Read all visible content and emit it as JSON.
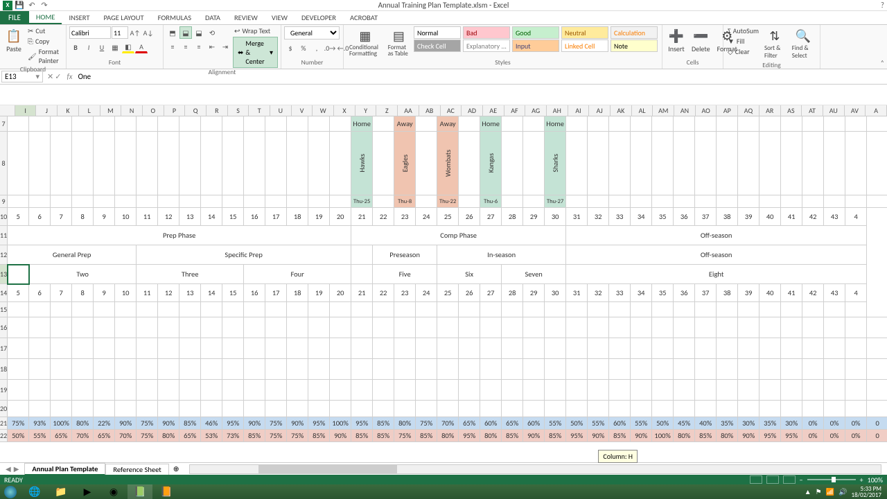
{
  "app": {
    "title": "Annual Training Plan Template.xlsm - Excel"
  },
  "qat": {
    "save": "💾",
    "undo": "↶",
    "redo": "↷"
  },
  "tabs": [
    "FILE",
    "HOME",
    "INSERT",
    "PAGE LAYOUT",
    "FORMULAS",
    "DATA",
    "REVIEW",
    "VIEW",
    "DEVELOPER",
    "ACROBAT"
  ],
  "ribbon": {
    "clipboard": {
      "label": "Clipboard",
      "paste": "Paste",
      "cut": "Cut",
      "copy": "Copy",
      "fp": "Format Painter"
    },
    "font": {
      "label": "Font",
      "name": "Calibri",
      "size": "11"
    },
    "alignment": {
      "label": "Alignment",
      "wrap": "Wrap Text",
      "merge": "Merge & Center"
    },
    "number": {
      "label": "Number",
      "format": "General"
    },
    "styles": {
      "label": "Styles",
      "cond": "Conditional Formatting",
      "fat": "Format as Table",
      "cells": [
        {
          "t": "Normal",
          "bg": "#fff",
          "c": "#000"
        },
        {
          "t": "Bad",
          "bg": "#ffc7ce",
          "c": "#9c0006"
        },
        {
          "t": "Good",
          "bg": "#c6efce",
          "c": "#006100"
        },
        {
          "t": "Neutral",
          "bg": "#ffeb9c",
          "c": "#9c5700"
        },
        {
          "t": "Calculation",
          "bg": "#f2f2f2",
          "c": "#fa7d00"
        },
        {
          "t": "Check Cell",
          "bg": "#a5a5a5",
          "c": "#fff"
        },
        {
          "t": "Explanatory ...",
          "bg": "#fff",
          "c": "#7f7f7f"
        },
        {
          "t": "Input",
          "bg": "#ffcc99",
          "c": "#3f3f76"
        },
        {
          "t": "Linked Cell",
          "bg": "#fff",
          "c": "#fa7d00"
        },
        {
          "t": "Note",
          "bg": "#ffffcc",
          "c": "#000"
        }
      ]
    },
    "cells_g": {
      "label": "Cells",
      "insert": "Insert",
      "delete": "Delete",
      "format": "Format"
    },
    "editing": {
      "label": "Editing",
      "autosum": "AutoSum",
      "fill": "Fill",
      "clear": "Clear",
      "sort": "Sort & Filter",
      "find": "Find & Select"
    }
  },
  "namebox": "E13",
  "formula": "One",
  "columns": [
    "I",
    "J",
    "K",
    "L",
    "M",
    "N",
    "O",
    "P",
    "Q",
    "R",
    "S",
    "T",
    "U",
    "V",
    "W",
    "X",
    "Y",
    "Z",
    "AA",
    "AB",
    "AC",
    "AD",
    "AE",
    "AF",
    "AG",
    "AH",
    "AI",
    "AJ",
    "AK",
    "AL",
    "AM",
    "AN",
    "AO",
    "AP",
    "AQ",
    "AR",
    "AS",
    "AT",
    "AU",
    "AV",
    "A"
  ],
  "games": [
    {
      "col": 16,
      "loc": "Home",
      "team": "Hawks",
      "date": "Thu-25",
      "cls": "home-cell"
    },
    {
      "col": 18,
      "loc": "Away",
      "team": "Eagles",
      "date": "Thu-8",
      "cls": "away-cell"
    },
    {
      "col": 20,
      "loc": "Away",
      "team": "Wombats",
      "date": "Thu-22",
      "cls": "away-cell"
    },
    {
      "col": 22,
      "loc": "Home",
      "team": "Kangas",
      "date": "Thu-6",
      "cls": "home-cell"
    },
    {
      "col": 25,
      "loc": "Home",
      "team": "Sharks",
      "date": "Thu-27",
      "cls": "home-cell"
    }
  ],
  "weeks": [
    "5",
    "6",
    "7",
    "8",
    "9",
    "10",
    "11",
    "12",
    "13",
    "14",
    "15",
    "16",
    "17",
    "18",
    "19",
    "20",
    "21",
    "22",
    "23",
    "24",
    "25",
    "26",
    "27",
    "28",
    "29",
    "30",
    "31",
    "32",
    "33",
    "34",
    "35",
    "36",
    "37",
    "38",
    "39",
    "40",
    "41",
    "42",
    "43",
    "4"
  ],
  "phases": [
    {
      "span": 16,
      "t": "Prep Phase"
    },
    {
      "span": 10,
      "t": "Comp Phase"
    },
    {
      "span": 14,
      "t": "Off-season"
    }
  ],
  "subphases": [
    {
      "span": 6,
      "t": "General Prep"
    },
    {
      "span": 10,
      "t": "Specific Prep"
    },
    {
      "span": 1,
      "t": ""
    },
    {
      "span": 3,
      "t": "Preseason"
    },
    {
      "span": 6,
      "t": "In-season"
    },
    {
      "span": 14,
      "t": "Off-season"
    }
  ],
  "meso": [
    {
      "span": 1,
      "t": "",
      "sel": true
    },
    {
      "span": 5,
      "t": "Two"
    },
    {
      "span": 5,
      "t": "Three"
    },
    {
      "span": 5,
      "t": "Four"
    },
    {
      "span": 1,
      "t": ""
    },
    {
      "span": 3,
      "t": "Five"
    },
    {
      "span": 3,
      "t": "Six"
    },
    {
      "span": 3,
      "t": "Seven"
    },
    {
      "span": 14,
      "t": "Eight"
    }
  ],
  "pct_blue": [
    "75%",
    "93%",
    "100%",
    "80%",
    "22%",
    "90%",
    "75%",
    "90%",
    "85%",
    "46%",
    "95%",
    "90%",
    "75%",
    "90%",
    "95%",
    "100%",
    "95%",
    "85%",
    "80%",
    "75%",
    "70%",
    "65%",
    "60%",
    "65%",
    "60%",
    "55%",
    "50%",
    "55%",
    "60%",
    "55%",
    "50%",
    "45%",
    "40%",
    "35%",
    "30%",
    "35%",
    "30%",
    "0%",
    "0%",
    "0%",
    "0"
  ],
  "pct_red": [
    "50%",
    "55%",
    "65%",
    "70%",
    "65%",
    "70%",
    "75%",
    "80%",
    "65%",
    "53%",
    "73%",
    "85%",
    "75%",
    "75%",
    "85%",
    "90%",
    "85%",
    "85%",
    "75%",
    "85%",
    "80%",
    "95%",
    "80%",
    "85%",
    "90%",
    "85%",
    "95%",
    "90%",
    "85%",
    "90%",
    "100%",
    "80%",
    "85%",
    "80%",
    "90%",
    "95%",
    "95%",
    "0%",
    "0%",
    "0%",
    "0"
  ],
  "sheets": {
    "active": "Annual Plan Template",
    "other": "Reference Sheet"
  },
  "scroll_tip": "Column: H",
  "status": {
    "ready": "READY",
    "zoom": "100%"
  },
  "clock": {
    "time": "5:33 PM",
    "date": "18/02/2017"
  }
}
